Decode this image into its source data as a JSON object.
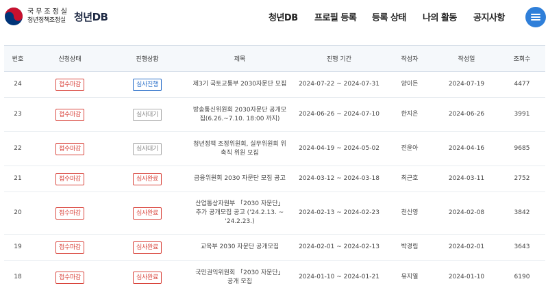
{
  "header": {
    "org_line1": "국무조정실",
    "org_line2": "청년정책조정실",
    "brand": "청년DB",
    "nav": [
      "청년DB",
      "프로필 등록",
      "등록 상태",
      "나의 활동",
      "공지사항"
    ]
  },
  "colors": {
    "accent": "#2f7fd9",
    "status_closed": "#d9453d",
    "status_in_progress": "#2a6fc9",
    "status_waiting": "#888888",
    "emblem_red": "#c8102e",
    "emblem_blue": "#003478"
  },
  "table": {
    "columns": [
      "번호",
      "신청상태",
      "진행상황",
      "제목",
      "진행 기간",
      "작성자",
      "작성일",
      "조회수"
    ],
    "rows": [
      {
        "no": "24",
        "apply": "접수마감",
        "progress": "심사진행",
        "progress_color": "blue",
        "title": "제3기 국토교통부 2030자문단 모집",
        "period": "2024-07-22 ~ 2024-07-31",
        "author": "양이든",
        "date": "2024-07-19",
        "views": "4477"
      },
      {
        "no": "23",
        "apply": "접수마감",
        "progress": "심사대기",
        "progress_color": "gray",
        "title": "방송통신위원회 2030자문단 공개모집(6.26.~7.10. 18:00 까지)",
        "period": "2024-06-26 ~ 2024-07-10",
        "author": "한지은",
        "date": "2024-06-26",
        "views": "3991"
      },
      {
        "no": "22",
        "apply": "접수마감",
        "progress": "심사대기",
        "progress_color": "gray",
        "title": "청년정책 조정위원회, 실무위원회 위촉직 위원 모집",
        "period": "2024-04-19 ~ 2024-05-02",
        "author": "전윤아",
        "date": "2024-04-16",
        "views": "9685"
      },
      {
        "no": "21",
        "apply": "접수마감",
        "progress": "심사완료",
        "progress_color": "red",
        "title": "금융위원회 2030 자문단 모집 공고",
        "period": "2024-03-12 ~ 2024-03-18",
        "author": "최근호",
        "date": "2024-03-11",
        "views": "2752"
      },
      {
        "no": "20",
        "apply": "접수마감",
        "progress": "심사완료",
        "progress_color": "red",
        "title": "산업통상자원부 「2030 자문단」 추가 공개모집 공고 ('24.2.13. ~ '24.2.23.)",
        "period": "2024-02-13 ~ 2024-02-23",
        "author": "천신영",
        "date": "2024-02-08",
        "views": "3842"
      },
      {
        "no": "19",
        "apply": "접수마감",
        "progress": "심사완료",
        "progress_color": "red",
        "title": "교육부 2030 자문단 공개모집",
        "period": "2024-02-01 ~ 2024-02-13",
        "author": "박경림",
        "date": "2024-02-01",
        "views": "3643"
      },
      {
        "no": "18",
        "apply": "접수마감",
        "progress": "심사완료",
        "progress_color": "red",
        "title": "국민권익위원회 「2030 자문단」 공개 모집",
        "period": "2024-01-10 ~ 2024-01-21",
        "author": "유지열",
        "date": "2024-01-10",
        "views": "6190"
      }
    ]
  }
}
